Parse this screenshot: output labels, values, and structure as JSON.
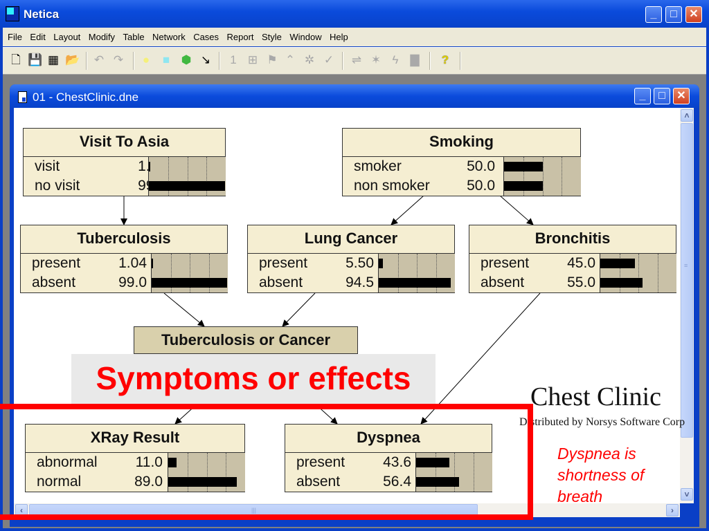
{
  "app": {
    "title": "Netica",
    "window_buttons": {
      "minimize": "_",
      "maximize": "□",
      "close": "✕"
    }
  },
  "menu": [
    "File",
    "Edit",
    "Layout",
    "Modify",
    "Table",
    "Network",
    "Cases",
    "Report",
    "Style",
    "Window",
    "Help"
  ],
  "toolbar": {
    "buttons": [
      {
        "name": "new-network-icon",
        "glyph": "🗋",
        "enabled": true
      },
      {
        "name": "save-icon",
        "glyph": "💾",
        "enabled": true
      },
      {
        "name": "save-as-icon",
        "glyph": "▦",
        "enabled": true
      },
      {
        "name": "open-icon",
        "glyph": "📂",
        "enabled": true
      },
      {
        "name": "undo-icon",
        "glyph": "↶",
        "enabled": false
      },
      {
        "name": "redo-icon",
        "glyph": "↷",
        "enabled": false
      },
      {
        "name": "add-nature-node-icon",
        "glyph": "●",
        "enabled": true
      },
      {
        "name": "add-decision-node-icon",
        "glyph": "■",
        "enabled": true
      },
      {
        "name": "add-utility-node-icon",
        "glyph": "⬢",
        "enabled": true
      },
      {
        "name": "add-link-icon",
        "glyph": "↘",
        "enabled": true
      },
      {
        "name": "enter-finding-icon",
        "glyph": "1",
        "enabled": false
      },
      {
        "name": "compile-icon",
        "glyph": "⊞",
        "enabled": false
      },
      {
        "name": "learn-icon",
        "glyph": "⚑",
        "enabled": false
      },
      {
        "name": "absorb-icon",
        "glyph": "⌃",
        "enabled": false
      },
      {
        "name": "remove-links-icon",
        "glyph": "✲",
        "enabled": false
      },
      {
        "name": "check-icon",
        "glyph": "✓",
        "enabled": false
      },
      {
        "name": "reverse-link-icon",
        "glyph": "⇌",
        "enabled": false
      },
      {
        "name": "sensitivity-icon",
        "glyph": "✶",
        "enabled": false
      },
      {
        "name": "lightning-icon",
        "glyph": "ϟ",
        "enabled": false
      },
      {
        "name": "table-icon",
        "glyph": "▇",
        "enabled": false
      },
      {
        "name": "help-icon",
        "glyph": "?",
        "enabled": true
      }
    ]
  },
  "document": {
    "title": "01 - ChestClinic.dne"
  },
  "nodes": [
    {
      "id": "visit-to-asia",
      "title": "Visit To Asia",
      "states": [
        {
          "name": "visit",
          "value": "1.00",
          "pct": 1.0
        },
        {
          "name": "no visit",
          "value": "99.0",
          "pct": 99.0
        }
      ]
    },
    {
      "id": "smoking",
      "title": "Smoking",
      "states": [
        {
          "name": "smoker",
          "value": "50.0",
          "pct": 50.0
        },
        {
          "name": "non smoker",
          "value": "50.0",
          "pct": 50.0
        }
      ]
    },
    {
      "id": "tuberculosis",
      "title": "Tuberculosis",
      "states": [
        {
          "name": "present",
          "value": "1.04",
          "pct": 1.04
        },
        {
          "name": "absent",
          "value": "99.0",
          "pct": 99.0
        }
      ]
    },
    {
      "id": "lung-cancer",
      "title": "Lung Cancer",
      "states": [
        {
          "name": "present",
          "value": "5.50",
          "pct": 5.5
        },
        {
          "name": "absent",
          "value": "94.5",
          "pct": 94.5
        }
      ]
    },
    {
      "id": "bronchitis",
      "title": "Bronchitis",
      "states": [
        {
          "name": "present",
          "value": "45.0",
          "pct": 45.0
        },
        {
          "name": "absent",
          "value": "55.0",
          "pct": 55.0
        }
      ]
    },
    {
      "id": "xray-result",
      "title": "XRay Result",
      "states": [
        {
          "name": "abnormal",
          "value": "11.0",
          "pct": 11.0
        },
        {
          "name": "normal",
          "value": "89.0",
          "pct": 89.0
        }
      ]
    },
    {
      "id": "dyspnea",
      "title": "Dyspnea",
      "states": [
        {
          "name": "present",
          "value": "43.6",
          "pct": 43.6
        },
        {
          "name": "absent",
          "value": "56.4",
          "pct": 56.4
        }
      ]
    }
  ],
  "tb_or_cancer": {
    "title": "Tuberculosis or Cancer"
  },
  "links": [
    [
      "visit-to-asia",
      "tuberculosis"
    ],
    [
      "smoking",
      "lung-cancer"
    ],
    [
      "smoking",
      "bronchitis"
    ],
    [
      "tuberculosis",
      "tb-or-cancer"
    ],
    [
      "lung-cancer",
      "tb-or-cancer"
    ],
    [
      "tb-or-cancer",
      "xray-result"
    ],
    [
      "tb-or-cancer",
      "dyspnea"
    ],
    [
      "bronchitis",
      "dyspnea"
    ]
  ],
  "annotations": {
    "symptoms_label": "Symptoms or effects",
    "network_title": "Chest Clinic",
    "network_subtitle": "Distributed by Norsys Software Corp",
    "note": "Dyspnea is shortness of breath"
  },
  "colors": {
    "node_fill": "#f5eed2",
    "bar_area": "#c9c1a7",
    "highlight_red": "#ff0000",
    "titlebar_blue": "#0b4bdc"
  }
}
